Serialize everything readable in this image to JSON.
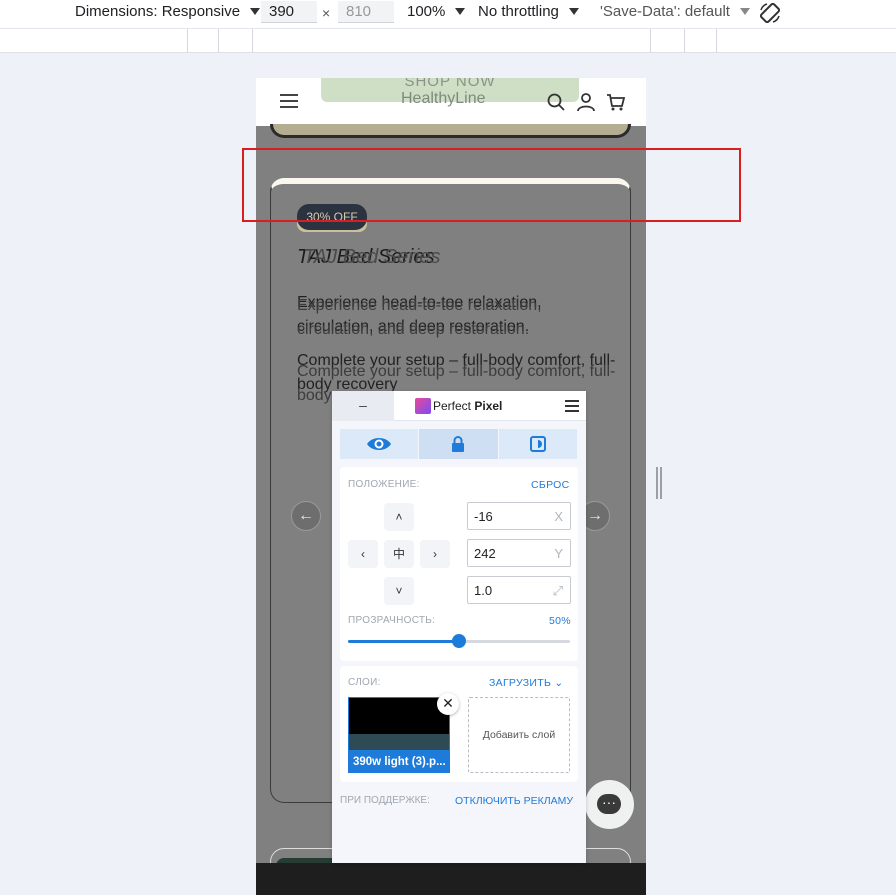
{
  "devtools": {
    "dimensions_label": "Dimensions: Responsive",
    "width": "390",
    "times": "×",
    "height": "810",
    "zoom": "100%",
    "throttling": "No throttling",
    "save_data": "'Save-Data': default"
  },
  "site": {
    "shop_now": "SHOP NOW",
    "logo": "HealthyLine",
    "badge": "30% OFF",
    "title": "TAJ Bed Series",
    "paragraph1": "Experience head-to-toe relaxation, circulation, and deep restoration.",
    "paragraph2": "Complete your setup – full-body comfort, full-body recovery",
    "prev": "←",
    "next": "→"
  },
  "perfect_pixel": {
    "minimize": "–",
    "brand_light": "Perfect ",
    "brand_bold": "Pixel",
    "position_label": "ПОЛОЖЕНИЕ:",
    "reset": "СБРОС",
    "x_value": "-16",
    "x_suffix": "X",
    "y_value": "242",
    "y_suffix": "Y",
    "scale_value": "1.0",
    "scale_suffix": "⤢",
    "opacity_label": "ПРОЗРАЧНОСТЬ:",
    "opacity_value": "50%",
    "opacity_fraction": 0.5,
    "layers_label": "СЛОИ:",
    "upload": "ЗАГРУЗИТЬ",
    "layer_name": "390w light (3).p...",
    "add_layer": "Добавить слой",
    "support_label": "ПРИ ПОДДЕРЖКЕ:",
    "disable_ads": "ОТКЛЮЧИТЬ РЕКЛАМУ",
    "nudge_up": "˄",
    "nudge_down": "˅",
    "nudge_left": "‹",
    "nudge_right": "›",
    "nudge_center": "中",
    "layer_close": "✕"
  },
  "colors": {
    "accent": "#1e7bd9",
    "overlay_gray": "#808080",
    "highlight_red": "#d81e1e"
  }
}
